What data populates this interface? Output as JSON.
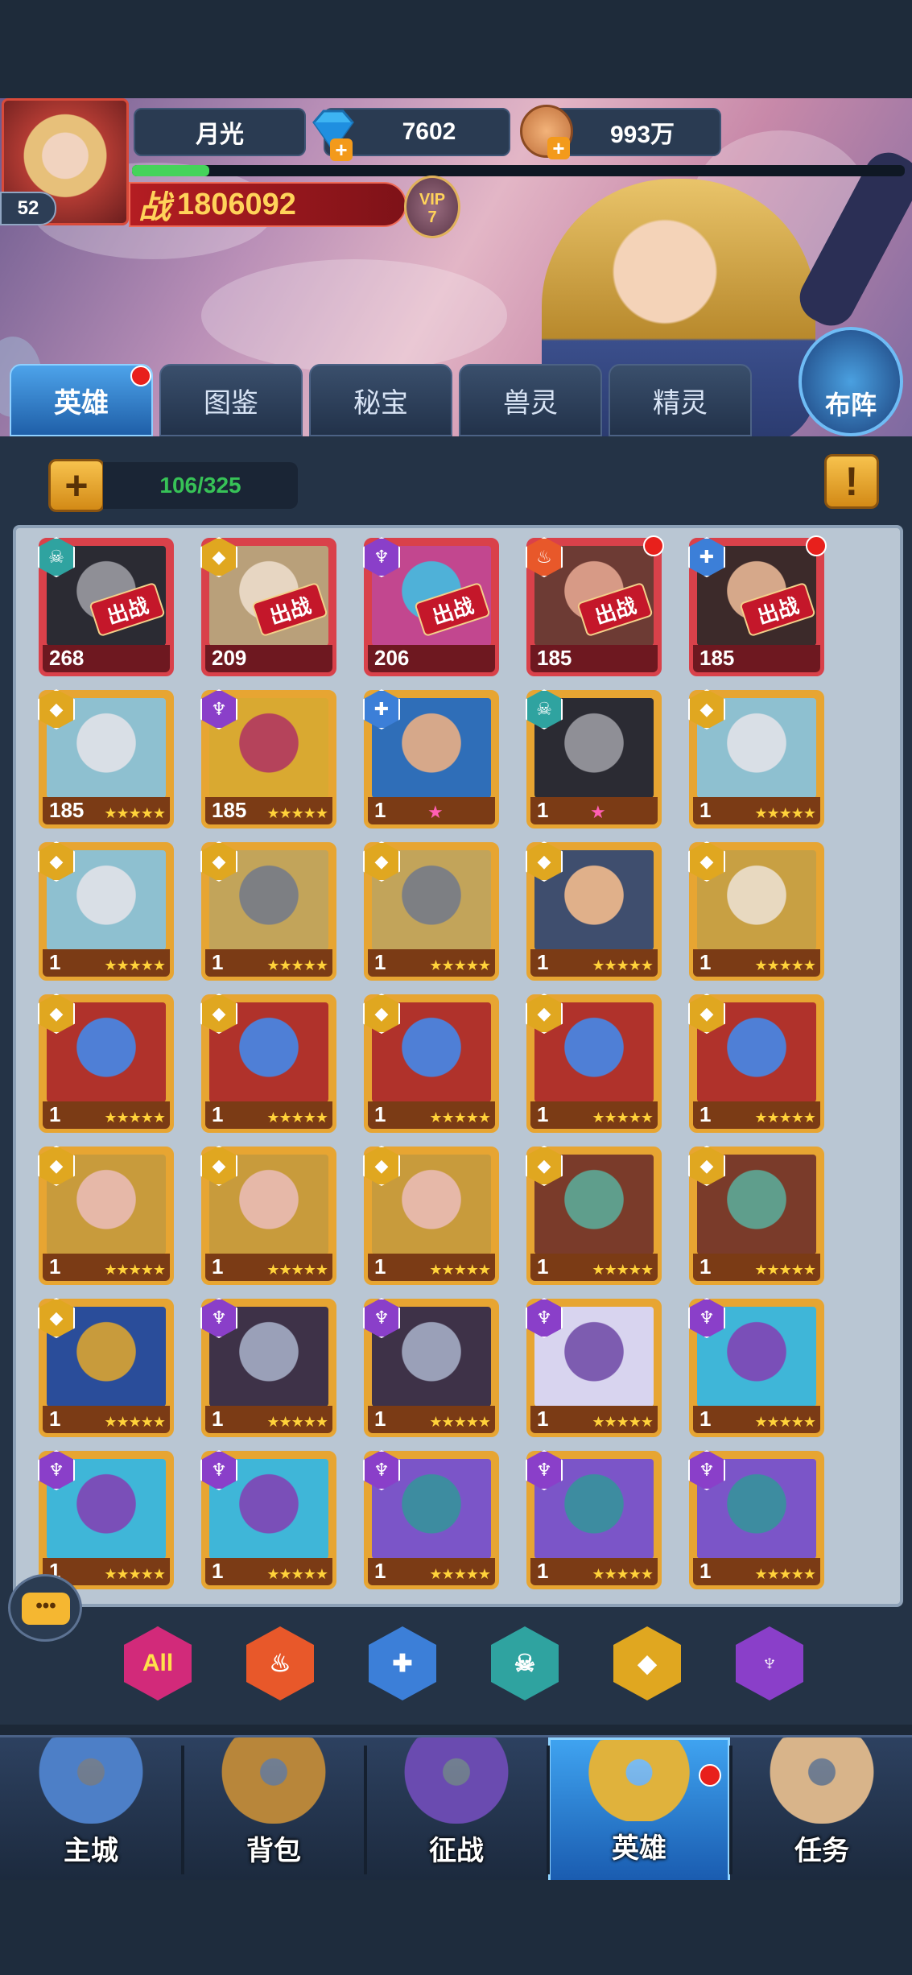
{
  "player": {
    "name": "月光",
    "level": "52",
    "diamonds": "7602",
    "coins": "993万",
    "xp_fraction": 0.1,
    "power_prefix": "战",
    "power": "1806092",
    "vip_label": "VIP",
    "vip_level": "7"
  },
  "tabs": [
    {
      "label": "英雄",
      "active": true,
      "has_dot": true
    },
    {
      "label": "图鉴",
      "active": false
    },
    {
      "label": "秘宝",
      "active": false
    },
    {
      "label": "兽灵",
      "active": false
    },
    {
      "label": "精灵",
      "active": false
    }
  ],
  "formation_button": "布阵",
  "add_button_icon": "+",
  "capacity": "106/325",
  "info_button_icon": "!",
  "deployed_label": "出战",
  "heroes": [
    {
      "faction": "dark",
      "level": "268",
      "deployed": true,
      "frame": "red",
      "portrait": [
        "#8f8f96",
        "#2b2b33"
      ]
    },
    {
      "faction": "light",
      "level": "209",
      "deployed": true,
      "frame": "red",
      "portrait": [
        "#e7d6c2",
        "#b9a07a"
      ]
    },
    {
      "faction": "void",
      "level": "206",
      "deployed": true,
      "frame": "red",
      "portrait": [
        "#4fb1d8",
        "#c2478f"
      ]
    },
    {
      "faction": "fire",
      "level": "185",
      "deployed": true,
      "frame": "red",
      "dot": true,
      "portrait": [
        "#d79a86",
        "#6d3b34"
      ]
    },
    {
      "faction": "holy",
      "level": "185",
      "deployed": true,
      "frame": "red",
      "dot": true,
      "portrait": [
        "#d6a88a",
        "#3c2a2a"
      ]
    },
    {
      "faction": "light",
      "level": "185",
      "stars": 5,
      "portrait": [
        "#d9dfe6",
        "#8ec0d0"
      ]
    },
    {
      "faction": "void",
      "level": "185",
      "stars": 5,
      "portrait": [
        "#b5435b",
        "#d9a931"
      ]
    },
    {
      "faction": "holy",
      "level": "1",
      "pink_star": true,
      "portrait": [
        "#d6a88a",
        "#2f6eb8"
      ]
    },
    {
      "faction": "dark",
      "level": "1",
      "pink_star": true,
      "portrait": [
        "#8f8f96",
        "#2b2b33"
      ]
    },
    {
      "faction": "light",
      "level": "1",
      "stars": 5,
      "portrait": [
        "#d9dfe6",
        "#8ec0d0"
      ]
    },
    {
      "faction": "light",
      "level": "1",
      "stars": 5,
      "portrait": [
        "#d9dfe6",
        "#8ec0d0"
      ]
    },
    {
      "faction": "light",
      "level": "1",
      "stars": 5,
      "portrait": [
        "#7d7f83",
        "#c2a45a"
      ]
    },
    {
      "faction": "light",
      "level": "1",
      "stars": 5,
      "portrait": [
        "#7d7f83",
        "#c2a45a"
      ]
    },
    {
      "faction": "light",
      "level": "1",
      "stars": 5,
      "portrait": [
        "#e0b08a",
        "#3f4e6e"
      ]
    },
    {
      "faction": "light",
      "level": "1",
      "stars": 5,
      "portrait": [
        "#e8d9c0",
        "#c8a043"
      ]
    },
    {
      "faction": "light",
      "level": "1",
      "stars": 5,
      "portrait": [
        "#4f7fd6",
        "#b0322b"
      ]
    },
    {
      "faction": "light",
      "level": "1",
      "stars": 5,
      "portrait": [
        "#4f7fd6",
        "#b0322b"
      ]
    },
    {
      "faction": "light",
      "level": "1",
      "stars": 5,
      "portrait": [
        "#4f7fd6",
        "#b0322b"
      ]
    },
    {
      "faction": "light",
      "level": "1",
      "stars": 5,
      "portrait": [
        "#4f7fd6",
        "#b0322b"
      ]
    },
    {
      "faction": "light",
      "level": "1",
      "stars": 5,
      "portrait": [
        "#4f7fd6",
        "#b0322b"
      ]
    },
    {
      "faction": "light",
      "level": "1",
      "stars": 5,
      "portrait": [
        "#e6b8a8",
        "#c89b3c"
      ]
    },
    {
      "faction": "light",
      "level": "1",
      "stars": 5,
      "portrait": [
        "#e6b8a8",
        "#c89b3c"
      ]
    },
    {
      "faction": "light",
      "level": "1",
      "stars": 5,
      "portrait": [
        "#e6b8a8",
        "#c89b3c"
      ]
    },
    {
      "faction": "light",
      "level": "1",
      "stars": 5,
      "portrait": [
        "#5f9e8c",
        "#7a3b2a"
      ]
    },
    {
      "faction": "light",
      "level": "1",
      "stars": 5,
      "portrait": [
        "#5f9e8c",
        "#7a3b2a"
      ]
    },
    {
      "faction": "light",
      "level": "1",
      "stars": 5,
      "portrait": [
        "#c89b3c",
        "#2a4d9a"
      ]
    },
    {
      "faction": "void",
      "level": "1",
      "stars": 5,
      "portrait": [
        "#9aa0b8",
        "#3e3248"
      ]
    },
    {
      "faction": "void",
      "level": "1",
      "stars": 5,
      "portrait": [
        "#9aa0b8",
        "#3e3248"
      ]
    },
    {
      "faction": "void",
      "level": "1",
      "stars": 5,
      "portrait": [
        "#7d5cb0",
        "#d8d4ef"
      ]
    },
    {
      "faction": "void",
      "level": "1",
      "stars": 5,
      "portrait": [
        "#7a4fb8",
        "#3fb6d8"
      ]
    },
    {
      "faction": "void",
      "level": "1",
      "stars": 5,
      "portrait": [
        "#7a4fb8",
        "#3fb6d8"
      ]
    },
    {
      "faction": "void",
      "level": "1",
      "stars": 5,
      "portrait": [
        "#7a4fb8",
        "#3fb6d8"
      ]
    },
    {
      "faction": "void",
      "level": "1",
      "stars": 5,
      "portrait": [
        "#3d8ca0",
        "#7b55c8"
      ]
    },
    {
      "faction": "void",
      "level": "1",
      "stars": 5,
      "portrait": [
        "#3d8ca0",
        "#7b55c8"
      ]
    },
    {
      "faction": "void",
      "level": "1",
      "stars": 5,
      "portrait": [
        "#3d8ca0",
        "#7b55c8"
      ]
    }
  ],
  "faction_filters": [
    {
      "name": "all",
      "label": "All"
    },
    {
      "name": "fire",
      "color": "#e8582a"
    },
    {
      "name": "holy",
      "color": "#3c7fd8"
    },
    {
      "name": "dark",
      "color": "#2fa3a0"
    },
    {
      "name": "light",
      "color": "#e0a720"
    },
    {
      "name": "void",
      "color": "#8a3fc9"
    }
  ],
  "chat_icon": "•••",
  "bottom_nav": [
    {
      "label": "主城",
      "icon": "castle-icon",
      "color": "#4d7fc7"
    },
    {
      "label": "背包",
      "icon": "treasure-chest-icon",
      "color": "#b8863a"
    },
    {
      "label": "征战",
      "icon": "dragon-portal-icon",
      "color": "#6a4bb0"
    },
    {
      "label": "英雄",
      "icon": "hero-helmet-icon",
      "color": "#e0b23c",
      "active": true,
      "has_dot": true
    },
    {
      "label": "任务",
      "icon": "scroll-icon",
      "color": "#d8b48a"
    }
  ]
}
